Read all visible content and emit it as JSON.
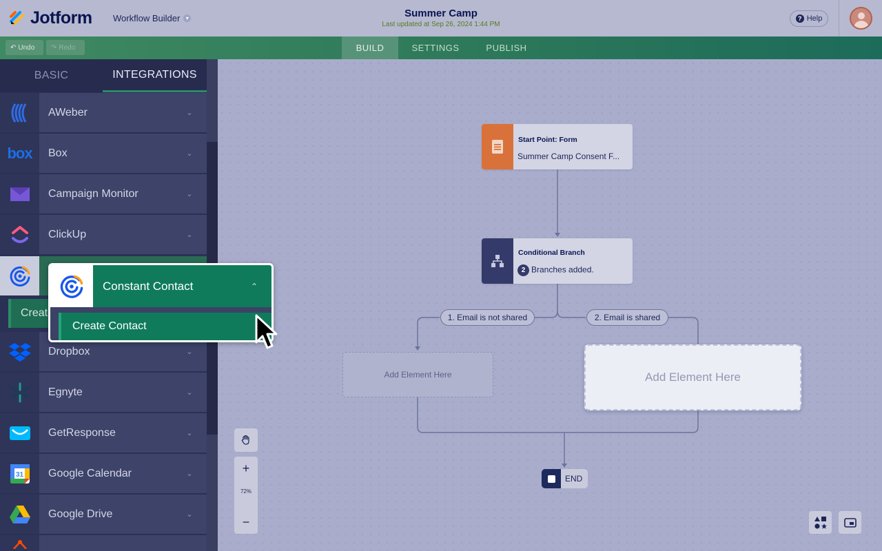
{
  "header": {
    "logo_text": "Jotform",
    "workflow_builder": "Workflow Builder",
    "title": "Summer Camp",
    "last_updated": "Last updated at Sep 26, 2024 1:44 PM",
    "help_label": "Help",
    "help_icon_glyph": "?"
  },
  "toolbar": {
    "undo_label": "Undo",
    "redo_label": "Redo",
    "tabs": [
      {
        "label": "BUILD",
        "active": true
      },
      {
        "label": "SETTINGS",
        "active": false
      },
      {
        "label": "PUBLISH",
        "active": false
      }
    ]
  },
  "sidebar": {
    "tabs": [
      {
        "label": "BASIC",
        "active": false
      },
      {
        "label": "INTEGRATIONS",
        "active": true
      }
    ],
    "items": [
      {
        "label": "AWeber",
        "icon": "aweber-icon"
      },
      {
        "label": "Box",
        "icon": "box-icon"
      },
      {
        "label": "Campaign Monitor",
        "icon": "campaign-monitor-icon"
      },
      {
        "label": "ClickUp",
        "icon": "clickup-icon"
      },
      {
        "label": "Constant Contact",
        "icon": "constant-contact-icon",
        "expanded": true
      },
      {
        "label": "Dropbox",
        "icon": "dropbox-icon"
      },
      {
        "label": "Egnyte",
        "icon": "egnyte-icon"
      },
      {
        "label": "GetResponse",
        "icon": "getresponse-icon"
      },
      {
        "label": "Google Calendar",
        "icon": "google-calendar-icon"
      },
      {
        "label": "Google Drive",
        "icon": "google-drive-icon"
      }
    ],
    "create_partial": "Create",
    "box_logo_text": "box",
    "calendar_day": "31"
  },
  "popup": {
    "title": "Constant Contact",
    "action": "Create Contact"
  },
  "canvas": {
    "start_node": {
      "title": "Start Point: Form",
      "subtitle": "Summer Camp Consent F..."
    },
    "branch_node": {
      "title": "Conditional Branch",
      "count": "2",
      "subtitle": "Branches added."
    },
    "branches": [
      {
        "label": "1. Email is not shared"
      },
      {
        "label": "2. Email is shared"
      }
    ],
    "add_element_small": "Add Element Here",
    "add_element_big": "Add Element Here",
    "end_label": "END",
    "zoom_level": "72%",
    "zoom_in": "+",
    "zoom_out": "−"
  },
  "colors": {
    "brand_navy": "#0a1551",
    "accent_green": "#0f7b5b",
    "start_orange": "#d9723a",
    "branch_navy": "#343b6a"
  }
}
